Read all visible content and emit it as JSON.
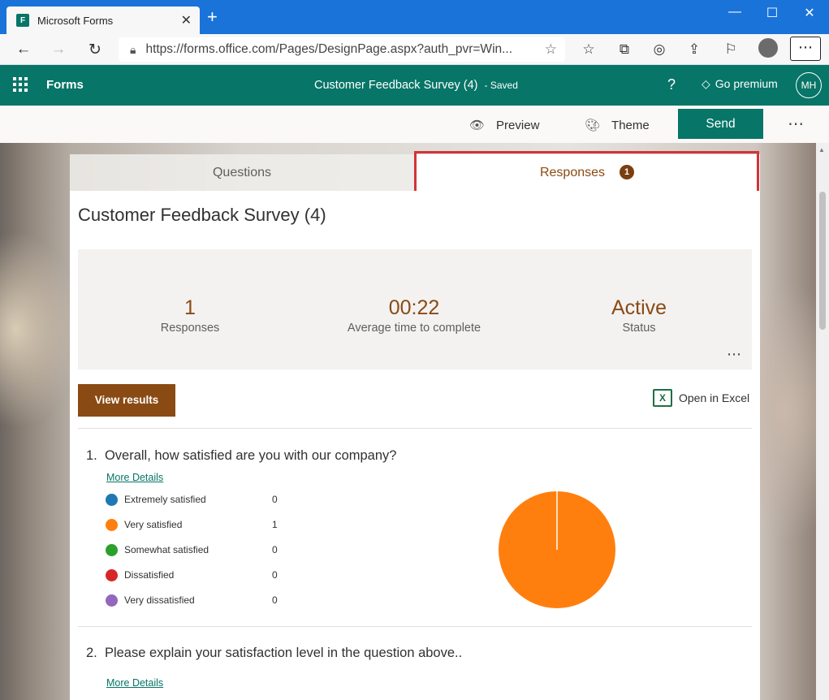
{
  "browser": {
    "tab_title": "Microsoft Forms",
    "tab_favicon": "F",
    "url": "https://forms.office.com/Pages/DesignPage.aspx?auth_pvr=Win...",
    "profile_initials": ""
  },
  "app": {
    "name": "Forms",
    "document_title": "Customer Feedback Survey (4)",
    "save_status": "Saved",
    "premium_label": "Go premium",
    "avatar_initials": "MH",
    "help_label": "?"
  },
  "commands": {
    "preview": "Preview",
    "theme": "Theme",
    "send": "Send"
  },
  "tabs": {
    "questions": "Questions",
    "responses": "Responses",
    "responses_badge": "1"
  },
  "form": {
    "title": "Customer Feedback Survey (4)",
    "stats": [
      {
        "value": "1",
        "label": "Responses"
      },
      {
        "value": "00:22",
        "label": "Average time to complete"
      },
      {
        "value": "Active",
        "label": "Status"
      }
    ],
    "view_results_label": "View results",
    "open_excel_label": "Open in Excel",
    "more_details_label": "More Details"
  },
  "questions": [
    {
      "number": "1.",
      "text": "Overall, how satisfied are you with our company?",
      "options": [
        {
          "label": "Extremely satisfied",
          "count": "0",
          "color": "#1f77b4"
        },
        {
          "label": "Very satisfied",
          "count": "1",
          "color": "#ff7f0e"
        },
        {
          "label": "Somewhat satisfied",
          "count": "0",
          "color": "#2ca02c"
        },
        {
          "label": "Dissatisfied",
          "count": "0",
          "color": "#d62728"
        },
        {
          "label": "Very dissatisfied",
          "count": "0",
          "color": "#9467bd"
        }
      ]
    },
    {
      "number": "2.",
      "text": "Please explain your satisfaction level in the question above.."
    }
  ],
  "chart_data": {
    "type": "pie",
    "categories": [
      "Extremely satisfied",
      "Very satisfied",
      "Somewhat satisfied",
      "Dissatisfied",
      "Very dissatisfied"
    ],
    "values": [
      0,
      1,
      0,
      0,
      0
    ],
    "colors": [
      "#1f77b4",
      "#ff7f0e",
      "#2ca02c",
      "#d62728",
      "#9467bd"
    ]
  },
  "theme": {
    "accent": "#077568",
    "brand_brown": "#8a4a13",
    "highlight_red": "#d13438",
    "titlebar_blue": "#1a73d9"
  }
}
